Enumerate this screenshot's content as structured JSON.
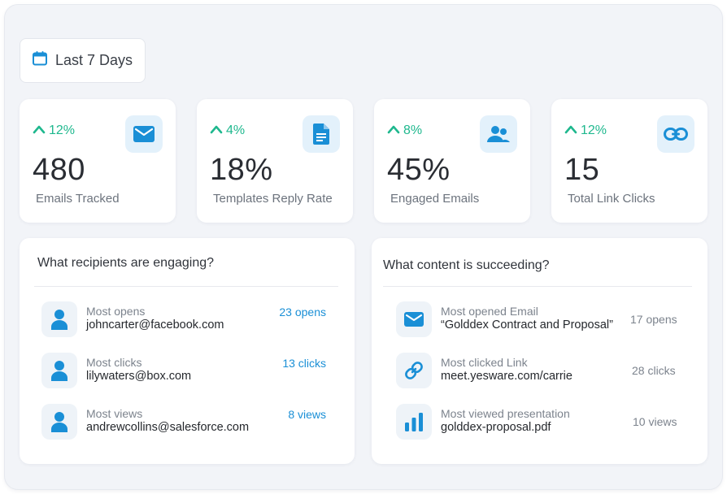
{
  "colors": {
    "accent": "#1a8fd6",
    "icon_bg": "#e3f1fb",
    "trend_up": "#1fb88e",
    "background": "#f2f4f8"
  },
  "date_filter": {
    "label": "Last 7 Days",
    "icon": "calendar-icon"
  },
  "stats": [
    {
      "trend": "12%",
      "value": "480",
      "caption": "Emails Tracked",
      "icon": "envelope-icon"
    },
    {
      "trend": "4%",
      "value": "18%",
      "caption": "Templates Reply Rate",
      "icon": "document-icon"
    },
    {
      "trend": "8%",
      "value": "45%",
      "caption": "Engaged Emails",
      "icon": "users-icon"
    },
    {
      "trend": "12%",
      "value": "15",
      "caption": "Total Link Clicks",
      "icon": "link-icon"
    }
  ],
  "recipients_panel": {
    "title": "What recipients are engaging?",
    "rows": [
      {
        "label": "Most opens",
        "value": "johncarter@facebook.com",
        "metric": "23 opens",
        "icon": "person-icon"
      },
      {
        "label": "Most clicks",
        "value": "lilywaters@box.com",
        "metric": "13 clicks",
        "icon": "person-icon"
      },
      {
        "label": "Most views",
        "value": "andrewcollins@salesforce.com",
        "metric": "8 views",
        "icon": "person-icon"
      }
    ]
  },
  "content_panel": {
    "title": "What content is succeeding?",
    "rows": [
      {
        "label": "Most opened Email",
        "value": "“Golddex Contract and Proposal”",
        "metric": "17  opens",
        "icon": "envelope-icon"
      },
      {
        "label": "Most clicked Link",
        "value": "meet.yesware.com/carrie",
        "metric": "28  clicks",
        "icon": "link-icon"
      },
      {
        "label": "Most viewed presentation",
        "value": "golddex-proposal.pdf",
        "metric": "10  views",
        "icon": "bar-chart-icon"
      }
    ]
  }
}
